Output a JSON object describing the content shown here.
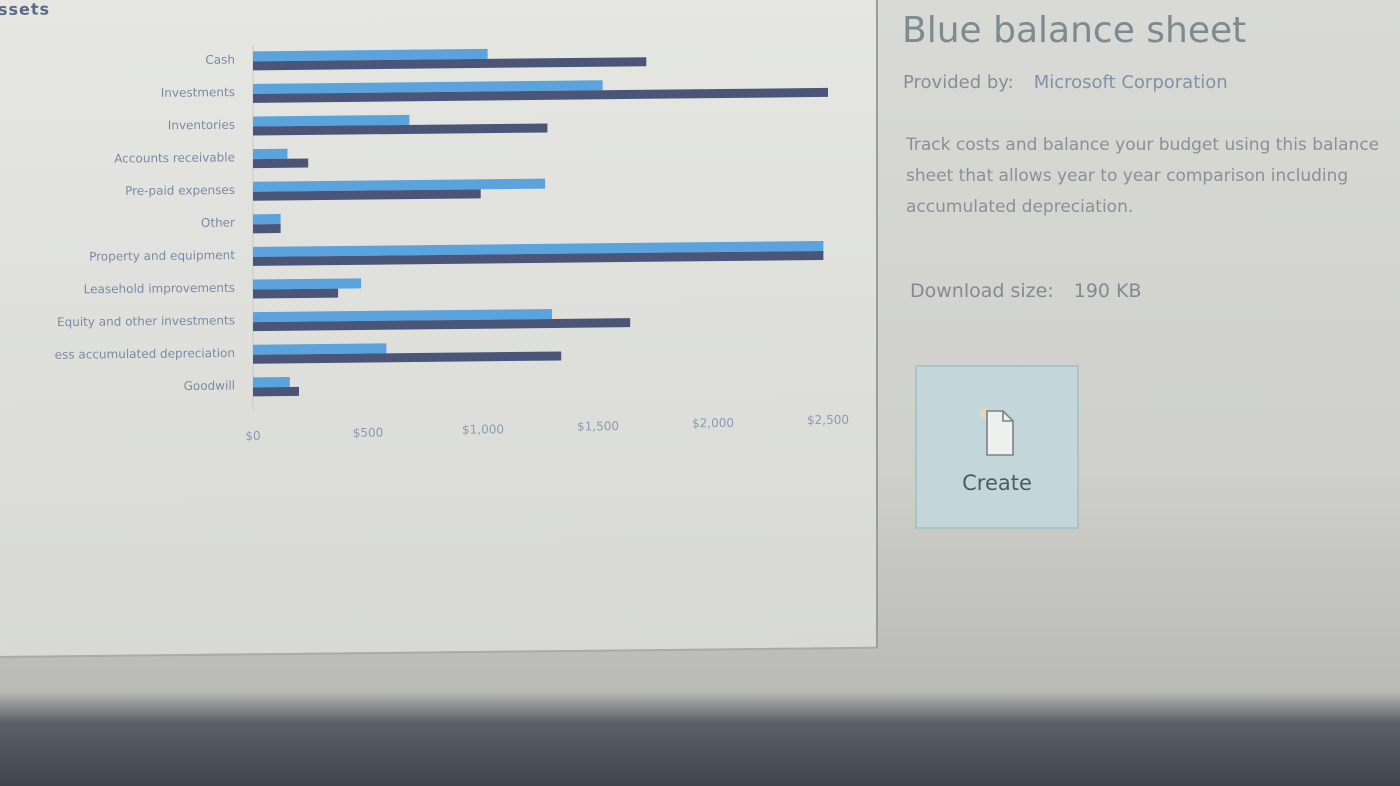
{
  "preview": {
    "chart_title": "ssets"
  },
  "chart_data": {
    "type": "bar",
    "orientation": "horizontal",
    "title": "ssets",
    "categories": [
      "Cash",
      "Investments",
      "Inventories",
      "Accounts receivable",
      "Pre-paid expenses",
      "Other",
      "Property and equipment",
      "Leasehold improvements",
      "Equity and other investments",
      "ess accumulated depreciation",
      "Goodwill"
    ],
    "series": [
      {
        "values": [
          1020,
          1520,
          680,
          150,
          1270,
          120,
          2480,
          470,
          1300,
          580,
          160
        ],
        "color": "#5aa3dc"
      },
      {
        "values": [
          1710,
          2500,
          1280,
          240,
          990,
          120,
          2480,
          370,
          1640,
          1340,
          200
        ],
        "color": "#4a5578"
      }
    ],
    "xlim": [
      0,
      2500
    ],
    "xticks": [
      "$0",
      "$500",
      "$1,000",
      "$1,500",
      "$2,000",
      "$2,500"
    ],
    "grid": false,
    "legend": "none"
  },
  "details": {
    "title": "Blue balance sheet",
    "provided_by_label": "Provided by:",
    "provider": "Microsoft Corporation",
    "description": "Track costs and balance your budget using this balance sheet that allows year to year comparison including accumulated depreciation.",
    "download_size_label": "Download size:",
    "download_size": "190 KB",
    "create_label": "Create",
    "create_icon": "new-document-icon"
  }
}
